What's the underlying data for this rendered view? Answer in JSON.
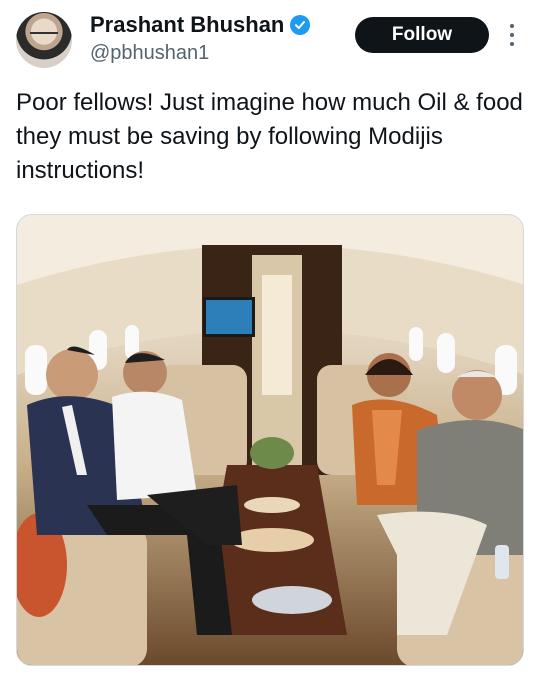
{
  "tweet": {
    "author_name": "Prashant Bhushan",
    "author_handle": "@pbhushan1",
    "follow_label": "Follow",
    "text": "Poor fellows! Just imagine how much Oil & food they must be saving by following Modijis instructions!"
  },
  "icons": {
    "verified": "verified-badge-icon",
    "more": "more-options-icon"
  },
  "colors": {
    "verified_blue": "#1d9bf0",
    "follow_bg": "#0f1419",
    "handle_gray": "#536471"
  }
}
